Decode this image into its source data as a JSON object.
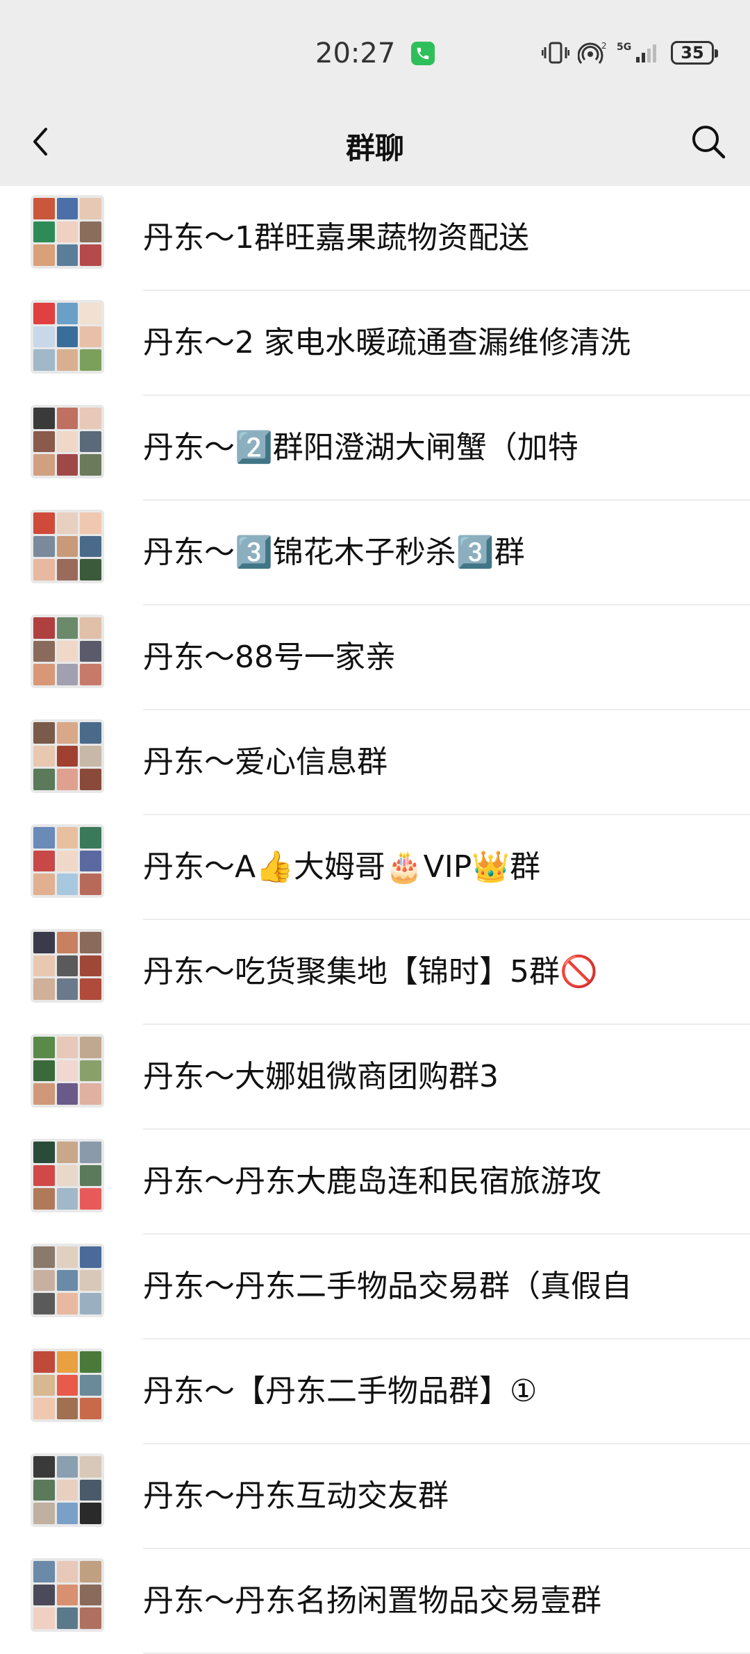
{
  "status_bar": {
    "time": "20:27",
    "battery": "35",
    "icons": [
      "phone-call-icon",
      "vibrate-icon",
      "hotspot-icon",
      "5g-signal-icon",
      "battery-icon"
    ]
  },
  "header": {
    "title": "群聊",
    "back_icon": "chevron-left-icon",
    "search_icon": "search-icon"
  },
  "groups": [
    {
      "name": "丹东～1群旺嘉果蔬物资配送"
    },
    {
      "name": "丹东～2 家电水暖疏通查漏维修清洗"
    },
    {
      "name": "丹东～2️⃣群阳澄湖大闸蟹（加特"
    },
    {
      "name": "丹东～3️⃣锦花木子秒杀3️⃣群"
    },
    {
      "name": "丹东～88号一家亲"
    },
    {
      "name": "丹东～爱心信息群"
    },
    {
      "name": "丹东～A👍大姆哥🎂VIP👑群"
    },
    {
      "name": "丹东～吃货聚集地【锦时】5群🚫"
    },
    {
      "name": "丹东～大娜姐微商团购群3"
    },
    {
      "name": "丹东～丹东大鹿岛连和民宿旅游攻"
    },
    {
      "name": "丹东～丹东二手物品交易群（真假自"
    },
    {
      "name": "丹东～【丹东二手物品群】①"
    },
    {
      "name": "丹东～丹东互动交友群"
    },
    {
      "name": "丹东～丹东名扬闲置物品交易壹群"
    }
  ],
  "colors": {
    "header_bg": "#ededed",
    "list_bg": "#ffffff",
    "divider": "#ececec"
  }
}
